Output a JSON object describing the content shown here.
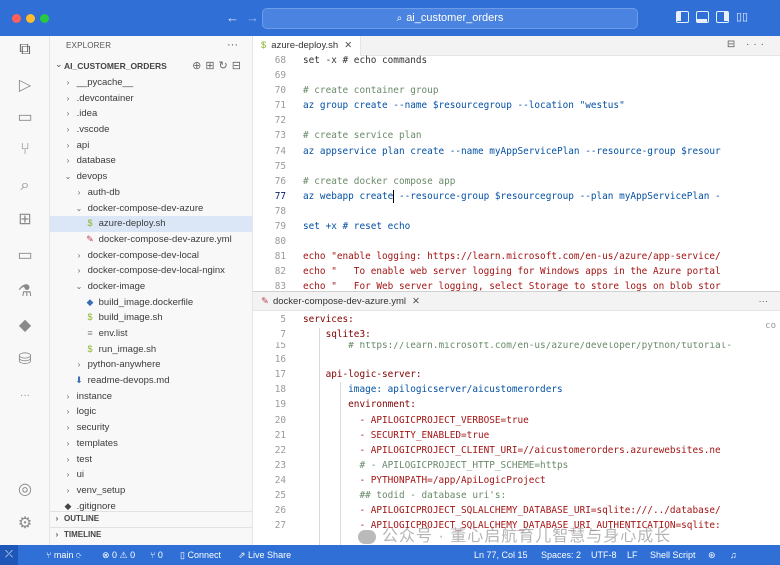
{
  "window": {
    "title": "ai_customer_orders"
  },
  "sidebar": {
    "header": "EXPLORER",
    "more": "···",
    "root": "AI_CUSTOMER_ORDERS",
    "items": [
      {
        "label": "__pycache__",
        "icon": "chevron-right"
      },
      {
        "label": ".devcontainer",
        "icon": "chevron-right"
      },
      {
        "label": ".idea",
        "icon": "chevron-right"
      },
      {
        "label": ".vscode",
        "icon": "chevron-right"
      },
      {
        "label": "api",
        "icon": "chevron-right"
      },
      {
        "label": "database",
        "icon": "chevron-right"
      },
      {
        "label": "devops",
        "icon": "chevron-down"
      },
      {
        "label": "auth-db",
        "icon": "chevron-right"
      },
      {
        "label": "docker-compose-dev-azure",
        "icon": "chevron-down"
      },
      {
        "label": "azure-deploy.sh",
        "icon": "shell-file"
      },
      {
        "label": "docker-compose-dev-azure.yml",
        "icon": "yaml-file"
      },
      {
        "label": "docker-compose-dev-local",
        "icon": "chevron-right"
      },
      {
        "label": "docker-compose-dev-local-nginx",
        "icon": "chevron-right"
      },
      {
        "label": "docker-image",
        "icon": "chevron-down"
      },
      {
        "label": "build_image.dockerfile",
        "icon": "docker-file"
      },
      {
        "label": "build_image.sh",
        "icon": "shell-file"
      },
      {
        "label": "env.list",
        "icon": "list-file"
      },
      {
        "label": "run_image.sh",
        "icon": "shell-file"
      },
      {
        "label": "python-anywhere",
        "icon": "chevron-right"
      },
      {
        "label": "readme-devops.md",
        "icon": "markdown-file"
      },
      {
        "label": "instance",
        "icon": "chevron-right"
      },
      {
        "label": "logic",
        "icon": "chevron-right"
      },
      {
        "label": "security",
        "icon": "chevron-right"
      },
      {
        "label": "templates",
        "icon": "chevron-right"
      },
      {
        "label": "test",
        "icon": "chevron-right"
      },
      {
        "label": "ui",
        "icon": "chevron-right"
      },
      {
        "label": "venv_setup",
        "icon": "chevron-right"
      },
      {
        "label": ".gitignore",
        "icon": "git-file"
      }
    ],
    "outline": "OUTLINE",
    "timeline": "TIMELINE"
  },
  "editor": {
    "tab_label": "azure-deploy.sh",
    "tab_close": "✕",
    "lines": [
      {
        "n": "68",
        "t": "set -x # echo commands"
      },
      {
        "n": "69",
        "t": ""
      },
      {
        "n": "70",
        "t": "# create container group"
      },
      {
        "n": "71",
        "t": "az group create --name $resourcegroup --location \"westus\""
      },
      {
        "n": "72",
        "t": ""
      },
      {
        "n": "73",
        "t": "# create service plan"
      },
      {
        "n": "74",
        "t": "az appservice plan create --name myAppServicePlan --resource-group $resour"
      },
      {
        "n": "75",
        "t": ""
      },
      {
        "n": "76",
        "t": "# create docker compose app"
      },
      {
        "n": "77",
        "t": "az webapp create --resource-group $resourcegroup --plan myAppServicePlan -"
      },
      {
        "n": "78",
        "t": ""
      },
      {
        "n": "79",
        "t": "set +x # reset echo"
      },
      {
        "n": "80",
        "t": ""
      },
      {
        "n": "81",
        "t": "echo \"enable logging: https://learn.microsoft.com/en-us/azure/app-service/"
      },
      {
        "n": "82",
        "t": "echo \"   To enable web server logging for Windows apps in the Azure portal"
      },
      {
        "n": "83",
        "t": "echo \"   For Web server logging, select Storage to store logs on blob stor"
      }
    ]
  },
  "peek": {
    "tab_label": "docker-compose-dev-azure.yml",
    "tab_close": "✕",
    "more": "···",
    "side_snippet": "co",
    "lines": [
      {
        "n": "5",
        "t": "services:"
      },
      {
        "n": "7",
        "t": "    sqlite3:"
      },
      {
        "n": "15",
        "t": "        # https://learn.microsoft.com/en-us/azure/developer/python/tutorial-"
      },
      {
        "n": "16",
        "t": ""
      },
      {
        "n": "17",
        "t": "    api-logic-server:"
      },
      {
        "n": "18",
        "t": "        image: apilogicserver/aicustomerorders"
      },
      {
        "n": "19",
        "t": "        environment:"
      },
      {
        "n": "20",
        "t": "          - APILOGICPROJECT_VERBOSE=true"
      },
      {
        "n": "21",
        "t": "          - SECURITY_ENABLED=true"
      },
      {
        "n": "22",
        "t": "          - APILOGICPROJECT_CLIENT_URI=//aicustomerorders.azurewebsites.ne"
      },
      {
        "n": "23",
        "t": "          # - APILOGICPROJECT_HTTP_SCHEME=https"
      },
      {
        "n": "24",
        "t": "          - PYTHONPATH=/app/ApiLogicProject"
      },
      {
        "n": "25",
        "t": "          ## todid - database uri's:"
      },
      {
        "n": "26",
        "t": "          - APILOGICPROJECT_SQLALCHEMY_DATABASE_URI=sqlite:///../database/"
      },
      {
        "n": "27",
        "t": "          - APILOGICPROJECT_SQLALCHEMY_DATABASE_URI_AUTHENTICATION=sqlite:"
      },
      {
        "n": "28",
        "t": ""
      }
    ]
  },
  "status": {
    "branch": "main",
    "sync": "⟳",
    "problems": "⊗ 0 ⚠ 0",
    "ports": "⑂ 0",
    "connect": "Connect",
    "liveshare": "Live Share",
    "position": "Ln 77, Col 15",
    "spaces": "Spaces: 2",
    "encoding": "UTF-8",
    "eol": "LF",
    "language": "Shell Script"
  },
  "watermark": "公众号 · 董心启航育儿智慧与身心成长",
  "colors": {
    "accent": "#2f6fd6",
    "sidebar_bg": "#f8f8f8",
    "selection": "#dbe6f7"
  }
}
